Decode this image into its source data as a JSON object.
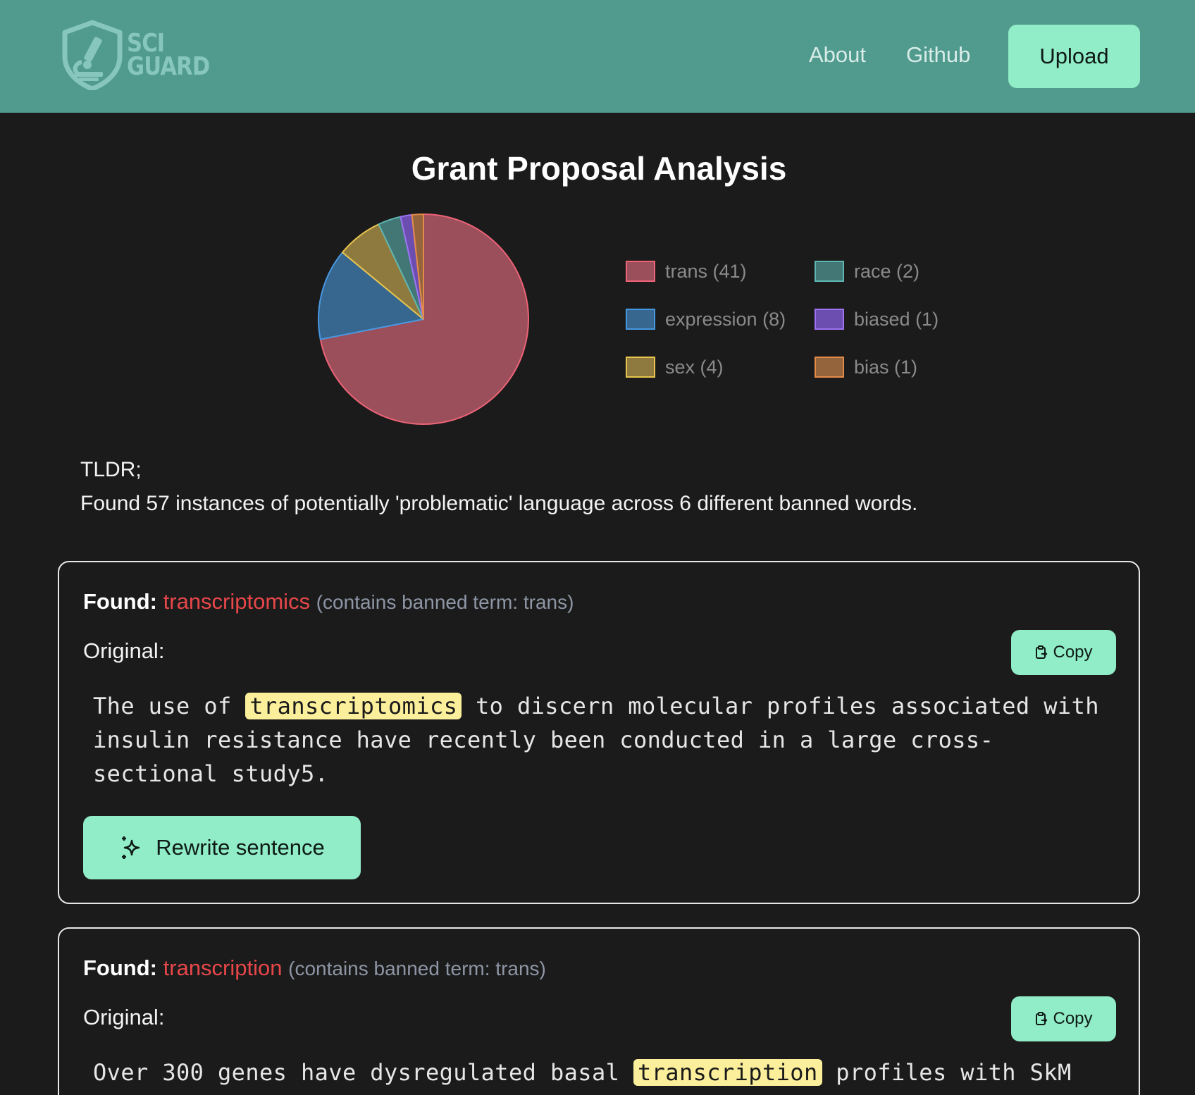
{
  "header": {
    "logo_line1": "SCI",
    "logo_line2": "GUARD",
    "nav": {
      "about": "About",
      "github": "Github",
      "upload": "Upload"
    }
  },
  "main": {
    "title": "Grant Proposal Analysis",
    "tldr_heading": "TLDR;",
    "tldr_text": "Found 57 instances of potentially 'problematic' language across 6 different banned words."
  },
  "chart_data": {
    "type": "pie",
    "categories": [
      "trans",
      "expression",
      "sex",
      "race",
      "biased",
      "bias"
    ],
    "values": [
      41,
      8,
      4,
      2,
      1,
      1
    ],
    "legend_labels": [
      "trans (41)",
      "expression (8)",
      "sex (4)",
      "race (2)",
      "biased (1)",
      "bias (1)"
    ],
    "fill_colors": [
      "#9a4f5b",
      "#37668f",
      "#8e7a3e",
      "#427775",
      "#6c4eb0",
      "#94643d"
    ],
    "stroke_colors": [
      "#ee6377",
      "#4798e2",
      "#e9c54e",
      "#5fb5b1",
      "#9d73f2",
      "#e58b4a"
    ],
    "legend_placement": "right"
  },
  "cards": [
    {
      "found_label": "Found:",
      "found_word": "transcriptomics",
      "note": "(contains banned term: trans)",
      "original_label": "Original:",
      "copy_label": "Copy",
      "sentence_before": "The use of ",
      "sentence_highlight": "transcriptomics",
      "sentence_after": " to discern molecular profiles associated with insulin resistance have recently been conducted in a large cross-sectional study5.",
      "rewrite_label": "Rewrite sentence"
    },
    {
      "found_label": "Found:",
      "found_word": "transcription",
      "note": "(contains banned term: trans)",
      "original_label": "Original:",
      "copy_label": "Copy",
      "sentence_before": "Over 300 genes have dysregulated basal ",
      "sentence_highlight": "transcription",
      "sentence_after": " profiles with SkM"
    }
  ]
}
